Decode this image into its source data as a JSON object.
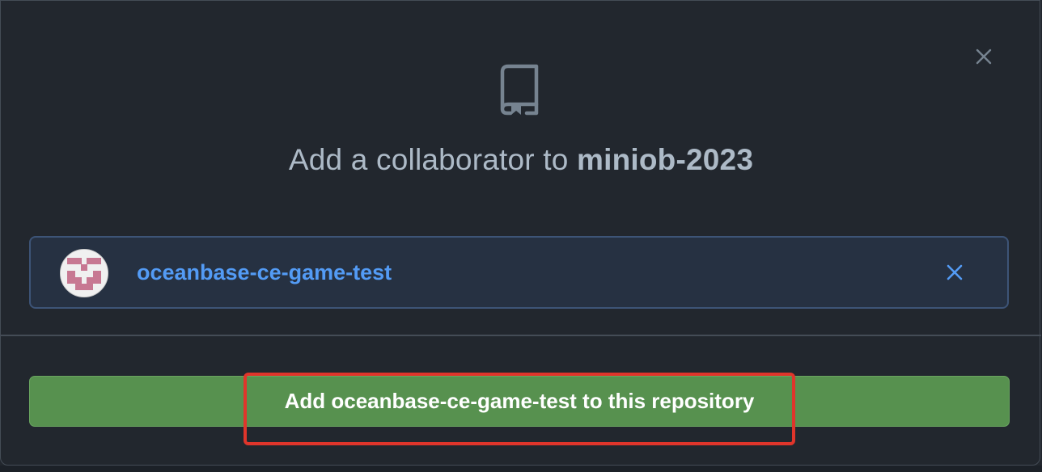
{
  "dialog": {
    "title_prefix": "Add a collaborator to ",
    "repo_name": "miniob-2023",
    "close_icon": "close-icon",
    "repo_icon": "repo-icon"
  },
  "selected_user": {
    "username": "oceanbase-ce-game-test",
    "remove_icon": "close-icon",
    "accent_color": "#539bf5"
  },
  "action": {
    "add_label": "Add oceanbase-ce-game-test to this repository",
    "button_color": "#57914f",
    "highlight_color": "#e0352b"
  }
}
